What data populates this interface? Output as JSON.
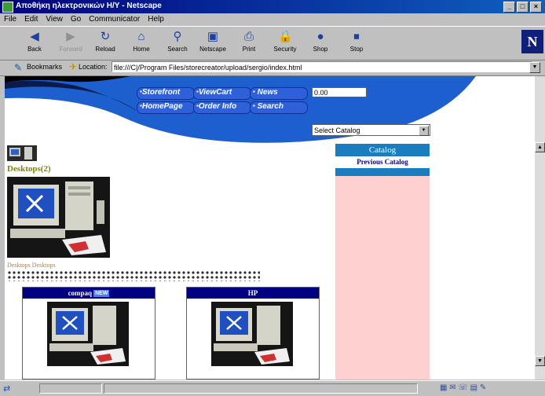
{
  "window": {
    "title": "Αποθήκη ηλεκτρονικών Η/Υ - Netscape",
    "controls": [
      "_",
      "□",
      "×"
    ]
  },
  "menu": [
    "File",
    "Edit",
    "View",
    "Go",
    "Communicator",
    "Help"
  ],
  "toolbar": [
    {
      "label": "Back",
      "icon": "back-arrow-icon",
      "glyph": "◀",
      "enabled": true
    },
    {
      "label": "Forward",
      "icon": "forward-arrow-icon",
      "glyph": "▶",
      "enabled": false
    },
    {
      "label": "Reload",
      "icon": "reload-icon",
      "glyph": "↻",
      "enabled": true
    },
    {
      "label": "Home",
      "icon": "home-icon",
      "glyph": "⌂",
      "enabled": true
    },
    {
      "label": "Search",
      "icon": "search-icon",
      "glyph": "⚲",
      "enabled": true
    },
    {
      "label": "Netscape",
      "icon": "netscape-icon",
      "glyph": "▣",
      "enabled": true
    },
    {
      "label": "Print",
      "icon": "print-icon",
      "glyph": "⎙",
      "enabled": true
    },
    {
      "label": "Security",
      "icon": "security-lock-icon",
      "glyph": "🔒",
      "enabled": true
    },
    {
      "label": "Shop",
      "icon": "shop-bag-icon",
      "glyph": "●",
      "enabled": true
    },
    {
      "label": "Stop",
      "icon": "stop-icon",
      "glyph": "⏹",
      "enabled": true
    }
  ],
  "location": {
    "bookmarks_label": "Bookmarks",
    "location_label": "Location:",
    "url": "file:///C|/Program Files/storecreator/upload/sergio/index.html"
  },
  "nav": {
    "links": [
      "Storefront",
      "ViewCart",
      "News",
      "HomePage",
      "Order Info",
      "Search"
    ],
    "search_value": "0.00",
    "select_value": "Select Catalog"
  },
  "catalog": {
    "header": "Catalog",
    "item": "Previous Catalog"
  },
  "main": {
    "section_title": "Desktops(2)",
    "subtitle": "Desktops Desktops"
  },
  "products": [
    {
      "name": "compaq",
      "badge": "NEW"
    },
    {
      "name": "HP",
      "badge": ""
    }
  ]
}
